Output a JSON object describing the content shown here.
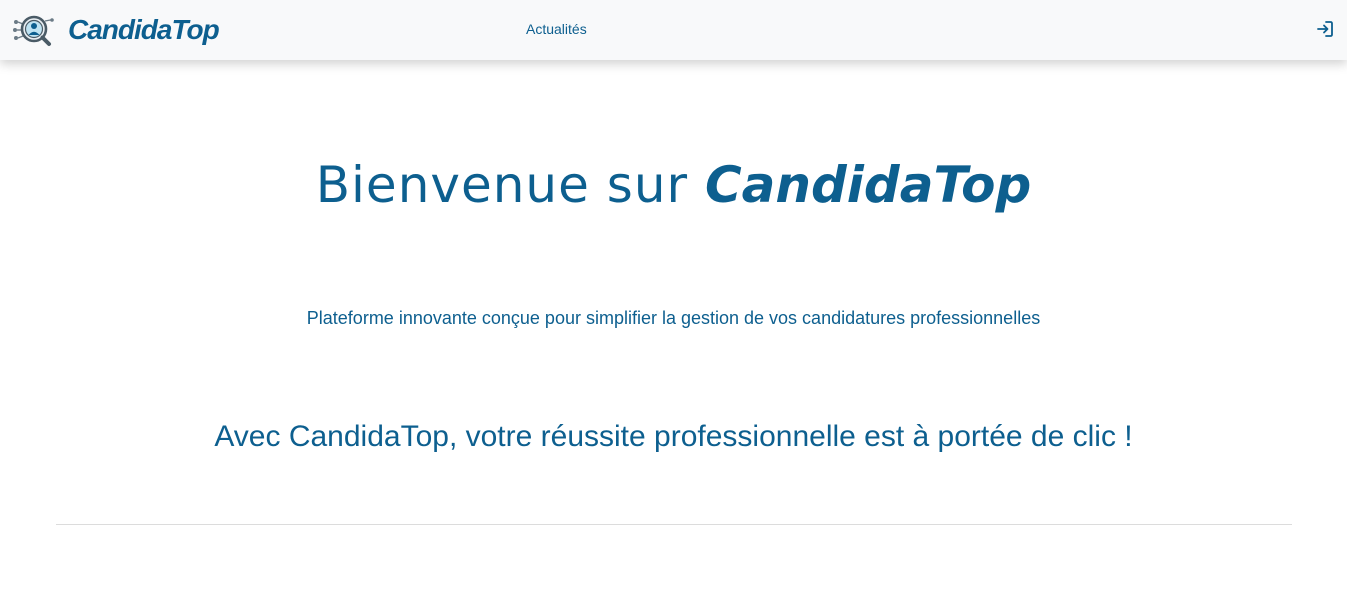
{
  "navbar": {
    "brand": {
      "name": "CandidaTop",
      "logo_icon": "magnifier-candidate-icon"
    },
    "links": [
      {
        "label": "Actualités"
      }
    ],
    "login_icon": "login-arrow-icon"
  },
  "hero": {
    "title_prefix": "Bienvenue sur ",
    "title_brand": "CandidaTop",
    "subtitle": "Plateforme innovante conçue pour simplifier la gestion de vos candidatures professionnelles",
    "tagline": "Avec CandidaTop, votre réussite professionnelle est à portée de clic !"
  },
  "colors": {
    "primary": "#0d5f8f",
    "navbar_bg": "#f8f9fa",
    "divider": "#dcdcdc"
  }
}
